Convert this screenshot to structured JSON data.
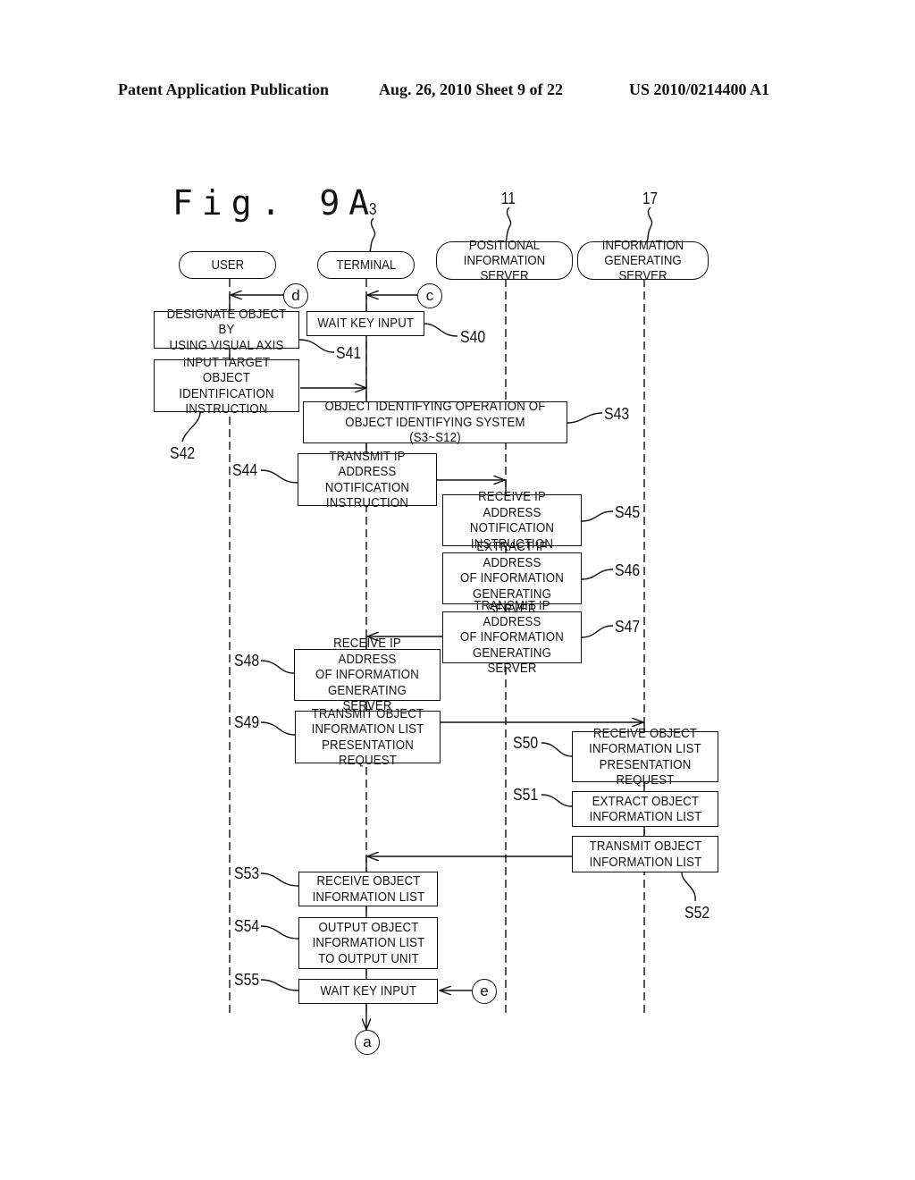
{
  "header": {
    "publication": "Patent Application Publication",
    "date_sheet": "Aug. 26, 2010  Sheet 9 of 22",
    "number": "US 2010/0214400 A1"
  },
  "figure": {
    "label": "Fig. 9A",
    "refs": {
      "terminal": "3",
      "positional": "11",
      "infogen": "17"
    }
  },
  "lanes": {
    "user": "USER",
    "terminal": "TERMINAL",
    "positional": "POSITIONAL\nINFORMATION SERVER",
    "infogen": "INFORMATION\nGENERATING SERVER"
  },
  "connectors": {
    "d": "d",
    "c": "c",
    "e": "e",
    "a": "a"
  },
  "steps": {
    "s40": {
      "id": "S40",
      "text": "WAIT KEY INPUT"
    },
    "s41": {
      "id": "S41",
      "text": "DESIGNATE OBJECT BY\nUSING VISUAL AXIS"
    },
    "s42": {
      "id": "S42",
      "text": "INPUT TARGET OBJECT\nIDENTIFICATION\nINSTRUCTION"
    },
    "s43": {
      "id": "S43",
      "text": "OBJECT IDENTIFYING OPERATION OF\nOBJECT IDENTIFYING SYSTEM (S3~S12)"
    },
    "s44": {
      "id": "S44",
      "text": "TRANSMIT IP ADDRESS\nNOTIFICATION\nINSTRUCTION"
    },
    "s45": {
      "id": "S45",
      "text": "RECEIVE IP ADDRESS\nNOTIFICATION\nINSTRUCTION"
    },
    "s46": {
      "id": "S46",
      "text": "EXTRACT IP ADDRESS\nOF INFORMATION\nGENERATING SERVER"
    },
    "s47": {
      "id": "S47",
      "text": "TRANSMIT IP ADDRESS\nOF INFORMATION\nGENERATING SERVER"
    },
    "s48": {
      "id": "S48",
      "text": "RECEIVE IP ADDRESS\nOF INFORMATION\nGENERATING SERVER"
    },
    "s49": {
      "id": "S49",
      "text": "TRANSMIT OBJECT\nINFORMATION LIST\nPRESENTATION REQUEST"
    },
    "s50": {
      "id": "S50",
      "text": "RECEIVE OBJECT\nINFORMATION LIST\nPRESENTATION REQUEST"
    },
    "s51": {
      "id": "S51",
      "text": "EXTRACT OBJECT\nINFORMATION LIST"
    },
    "s52": {
      "id": "S52",
      "text": "TRANSMIT OBJECT\nINFORMATION LIST"
    },
    "s53": {
      "id": "S53",
      "text": "RECEIVE OBJECT\nINFORMATION LIST"
    },
    "s54": {
      "id": "S54",
      "text": "OUTPUT OBJECT\nINFORMATION LIST\nTO OUTPUT UNIT"
    },
    "s55": {
      "id": "S55",
      "text": "WAIT KEY INPUT"
    }
  }
}
